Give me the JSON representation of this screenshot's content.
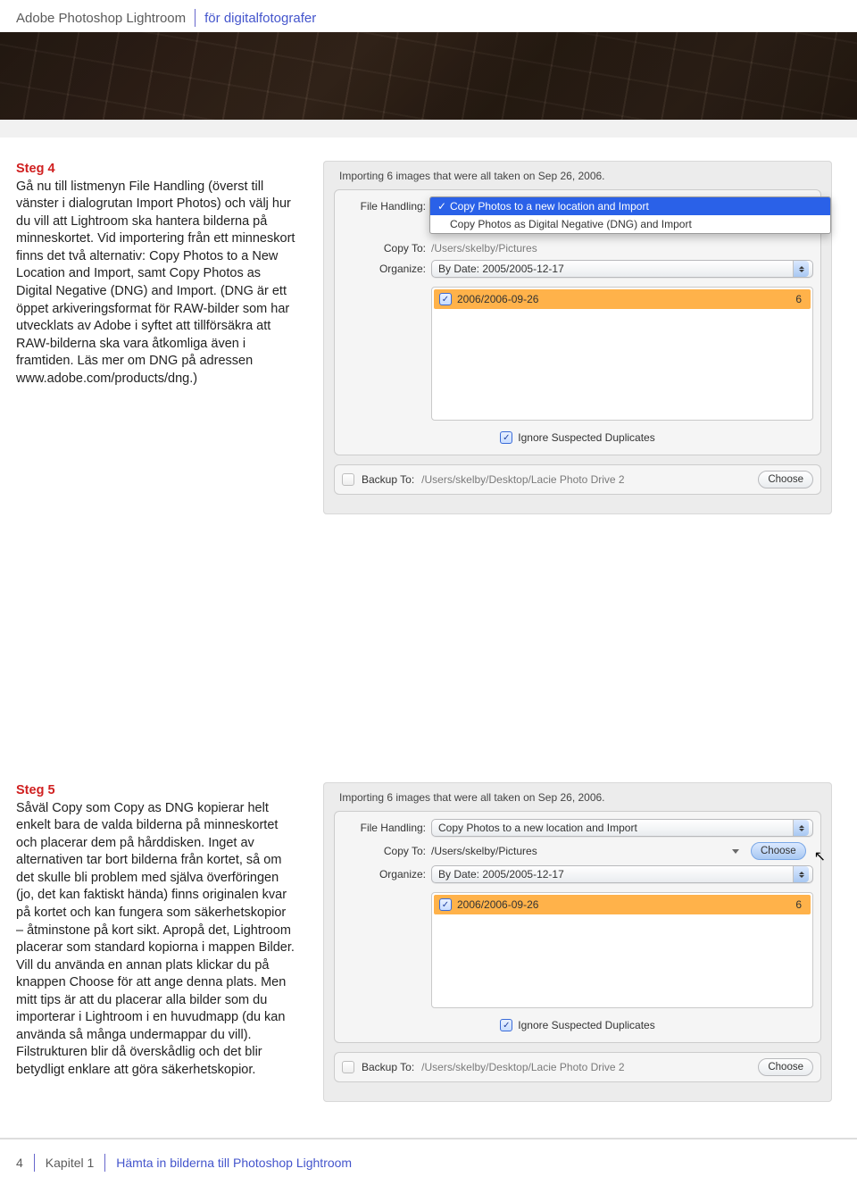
{
  "header": {
    "product": "Adobe Photoshop Lightroom",
    "subtitle": "för digitalfotografer"
  },
  "step4": {
    "heading": "Steg 4",
    "body": "Gå nu till listmenyn File Handling (överst till vänster i dialogrutan Import Photos) och välj hur du vill att Lightroom ska hantera bilderna på minneskortet. Vid importering från ett minneskort finns det två alternativ: Copy Photos to a New Location and Import, samt Copy Photos as Digital Negative (DNG) and Import. (DNG är ett öppet arkiveringsformat för RAW-bilder som har utvecklats av Adobe i syftet att tillförsäkra att RAW-bilderna ska vara åtkomliga även i framtiden. Läs mer om DNG på adressen www.adobe.com/products/dng.)"
  },
  "step5": {
    "heading": "Steg 5",
    "body": "Såväl Copy som Copy as DNG kopierar helt enkelt bara de valda bilderna på minneskortet och placerar dem på hårddisken. Inget av alternativen tar bort bilderna från kortet, så om det skulle bli problem med själva överföringen (jo, det kan faktiskt hända) finns originalen kvar på kortet och kan fungera som säkerhetskopior – åtminstone på kort sikt. Apropå det, Lightroom placerar som standard kopiorna i mappen Bilder. Vill du använda en annan plats klickar du på knappen Choose för att ange denna plats. Men mitt tips är att du placerar alla bilder som du importerar i Lightroom i en huvudmapp (du kan använda så många undermappar du vill). Filstrukturen blir då överskådlig och det blir betydligt enklare att göra säkerhetskopior."
  },
  "dialog": {
    "title": "Importing 6 images that were all taken on Sep 26, 2006.",
    "labels": {
      "file_handling": "File Handling:",
      "copy_to": "Copy To:",
      "organize": "Organize:",
      "backup_to": "Backup To:"
    },
    "file_handling_value": "Copy Photos to a new location and Import",
    "file_handling_options": [
      "Copy Photos to a new location and Import",
      "Copy Photos as Digital Negative (DNG) and Import"
    ],
    "copy_to_path_masked": "/Users/skelby/Pictures",
    "organize_value": "By Date: 2005/2005-12-17",
    "folder_name": "2006/2006-09-26",
    "folder_count": "6",
    "ignore_dupes": "Ignore Suspected Duplicates",
    "backup_path": "/Users/skelby/Desktop/Lacie Photo Drive 2",
    "choose": "Choose"
  },
  "footer": {
    "page": "4",
    "chapter": "Kapitel 1",
    "chapter_title": "Hämta in bilderna till Photoshop Lightroom"
  }
}
